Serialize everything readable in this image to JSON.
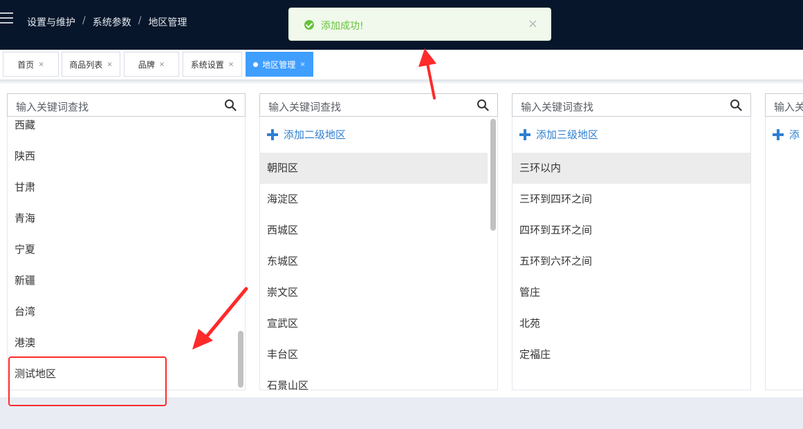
{
  "breadcrumb": [
    "设置与维护",
    "系统参数",
    "地区管理"
  ],
  "breadcrumb_sep": "/",
  "toast": {
    "message": "添加成功!",
    "close": "×"
  },
  "tabs": [
    {
      "label": "首页",
      "close": "×"
    },
    {
      "label": "商品列表",
      "close": "×"
    },
    {
      "label": "品牌",
      "close": "×"
    },
    {
      "label": "系统设置",
      "close": "×"
    },
    {
      "label": "地区管理",
      "close": "×",
      "active": true
    }
  ],
  "columns": [
    {
      "placeholder": "输入关键词查找",
      "items": [
        "西藏",
        "陕西",
        "甘肃",
        "青海",
        "宁夏",
        "新疆",
        "台湾",
        "港澳",
        "测试地区"
      ]
    },
    {
      "placeholder": "输入关键词查找",
      "add_label": "添加二级地区",
      "items": [
        "朝阳区",
        "海淀区",
        "西城区",
        "东城区",
        "崇文区",
        "宣武区",
        "丰台区",
        "石景山区"
      ],
      "selected_index": 0
    },
    {
      "placeholder": "输入关键词查找",
      "add_label": "添加三级地区",
      "items": [
        "三环以内",
        "三环到四环之间",
        "四环到五环之间",
        "五环到六环之间",
        "管庄",
        "北苑",
        "定福庄"
      ],
      "selected_index": 0
    },
    {
      "placeholder": "输入关",
      "add_label": "添"
    }
  ],
  "colors": {
    "topbar": "#07162b",
    "accent": "#409eff",
    "success": "#67c23a",
    "link": "#2f7fd1",
    "annotation": "#ff2a2a"
  }
}
